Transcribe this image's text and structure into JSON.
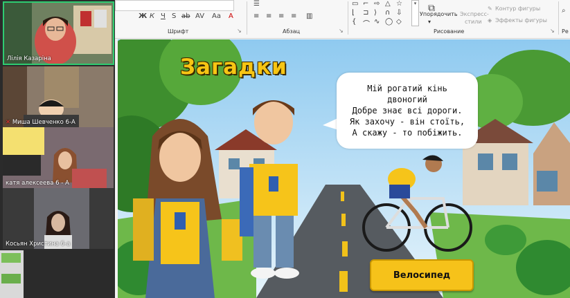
{
  "ribbon": {
    "font_group_label": "Шрифт",
    "paragraph_group_label": "Абзац",
    "drawing_group_label": "Рисование",
    "edit_group_label_partial": "Ре",
    "arrange_label": "Упорядочить",
    "quick_styles_label_line1": "Экспресс-",
    "quick_styles_label_line2": "стили",
    "shape_outline_label": "Контур фигуры",
    "shape_effects_label": "Эффекты фигуры",
    "font_buttons": [
      "Ж",
      "К",
      "Ч",
      "S",
      "ab",
      "AV",
      "Aa",
      "A"
    ],
    "font_size_value": ""
  },
  "participants": [
    {
      "name": "Лілія Казаріна",
      "active": true
    },
    {
      "name": "Миша Шевченко 6-А",
      "active": false
    },
    {
      "name": "катя алексеева 6 - А",
      "active": false
    },
    {
      "name": "Косьян Христина 6-а",
      "active": false
    }
  ],
  "slide": {
    "title": "Загадки",
    "riddle_lines": [
      "Мій рогатий кінь",
      "двоногий",
      "Добре знає всі дороги.",
      "Як захочу - він стоїть,",
      "А скажу - то побіжить."
    ],
    "answer_label": "Велосипед"
  },
  "colors": {
    "accent_yellow": "#f6c21a",
    "active_tile_border": "#2ecc71",
    "title_yellow": "#f7c514"
  }
}
